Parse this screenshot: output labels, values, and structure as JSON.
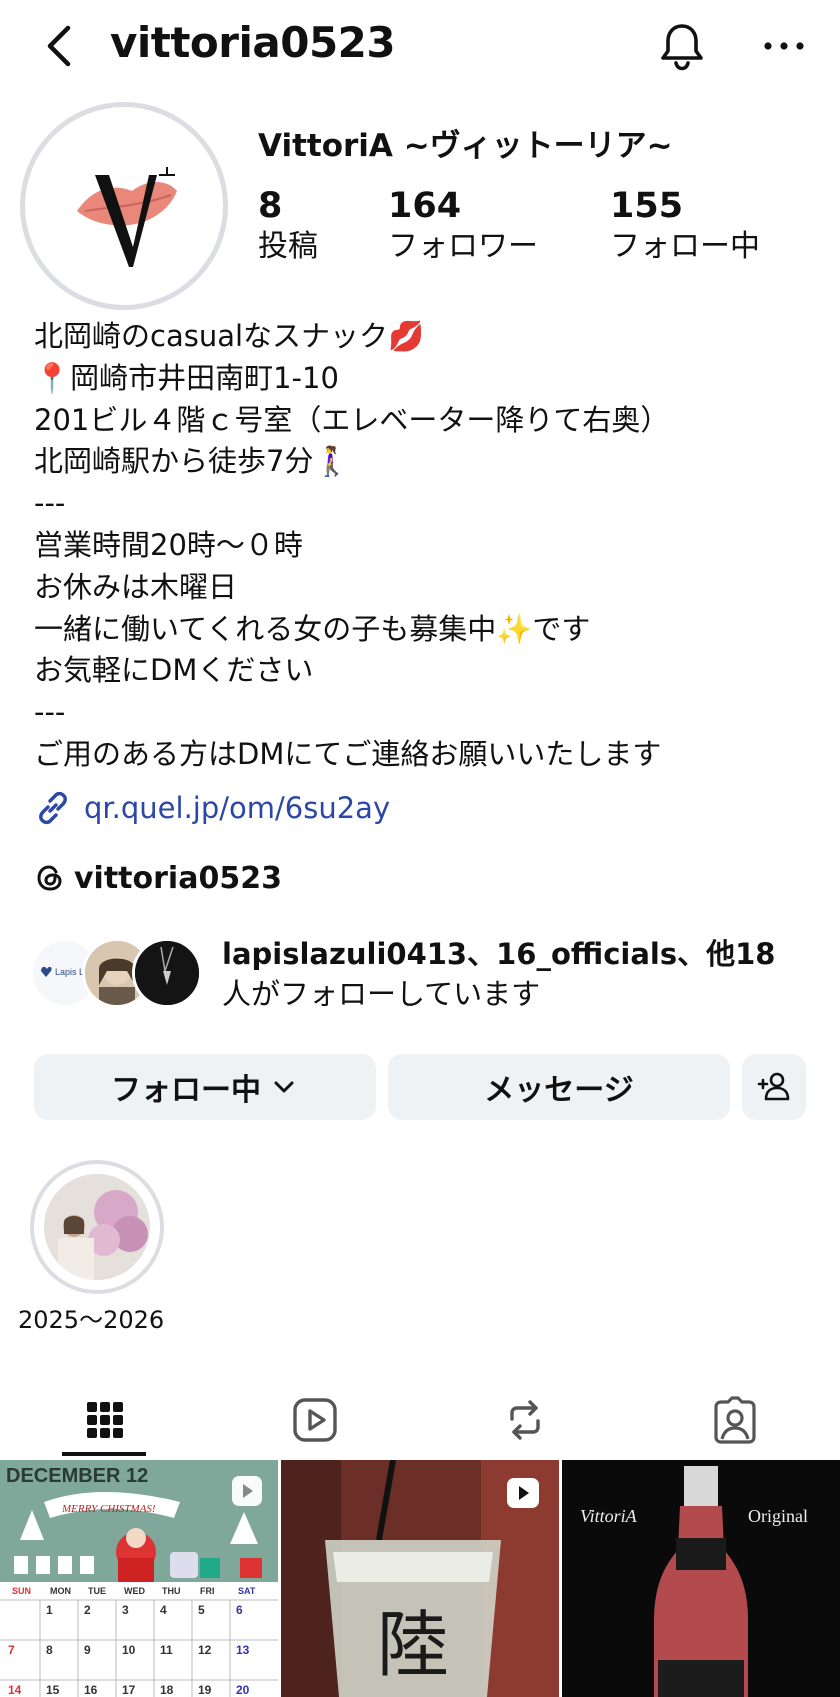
{
  "header": {
    "username": "vittoria0523",
    "back_icon": "chevron-left-icon",
    "bell_icon": "bell-icon",
    "more_icon": "more-horizontal-icon"
  },
  "profile": {
    "display_name": "VittoriA ~ヴィットーリア~",
    "avatar_icon": "vittoria-logo",
    "stats": [
      {
        "value": "8",
        "label": "投稿"
      },
      {
        "value": "164",
        "label": "フォロワー"
      },
      {
        "value": "155",
        "label": "フォロー中"
      }
    ],
    "bio_lines": [
      "北岡崎のcasualなスナック💋",
      "📍岡崎市井田南町1-10",
      "201ビル４階ｃ号室（エレベーター降りて右奥）",
      "北岡崎駅から徒歩7分🚶‍♀️",
      "---",
      "営業時間20時〜０時",
      "お休みは木曜日",
      "一緒に働いてくれる女の子も募集中✨です",
      "お気軽にDMください",
      "---",
      "ご用のある方はDMにてご連絡お願いいたします"
    ],
    "link": "qr.quel.jp/om/6su2ay",
    "threads_handle": "vittoria0523"
  },
  "followed_by": {
    "names": "lapislazuli0413、16_officials、他18",
    "suffix": "人がフォローしています",
    "avatar1_label": "Lapis Lazuli"
  },
  "actions": {
    "follow_label": "フォロー中",
    "message_label": "メッセージ",
    "add_user_icon": "add-user-icon"
  },
  "highlights": [
    {
      "label": "2025〜2026"
    }
  ],
  "tabs": [
    {
      "icon": "grid-icon",
      "active": true
    },
    {
      "icon": "reels-icon",
      "active": false
    },
    {
      "icon": "repost-icon",
      "active": false
    },
    {
      "icon": "tagged-icon",
      "active": false
    }
  ],
  "posts": [
    {
      "title": "DECEMBER 12",
      "subtitle": "MERRY CHISTMAS!",
      "days": [
        "SUN",
        "MON",
        "TUE",
        "WED",
        "THU",
        "FRI",
        "SAT"
      ],
      "dates": [
        "1",
        "2",
        "3",
        "4",
        "5",
        "6",
        "7",
        "8",
        "9",
        "10",
        "11",
        "12",
        "13",
        "14",
        "15",
        "16",
        "17",
        "18",
        "19",
        "20"
      ],
      "type": "reel"
    },
    {
      "text": "陸",
      "type": "reel"
    },
    {
      "brand": "VittoriA",
      "label": "Original",
      "type": "post"
    }
  ]
}
